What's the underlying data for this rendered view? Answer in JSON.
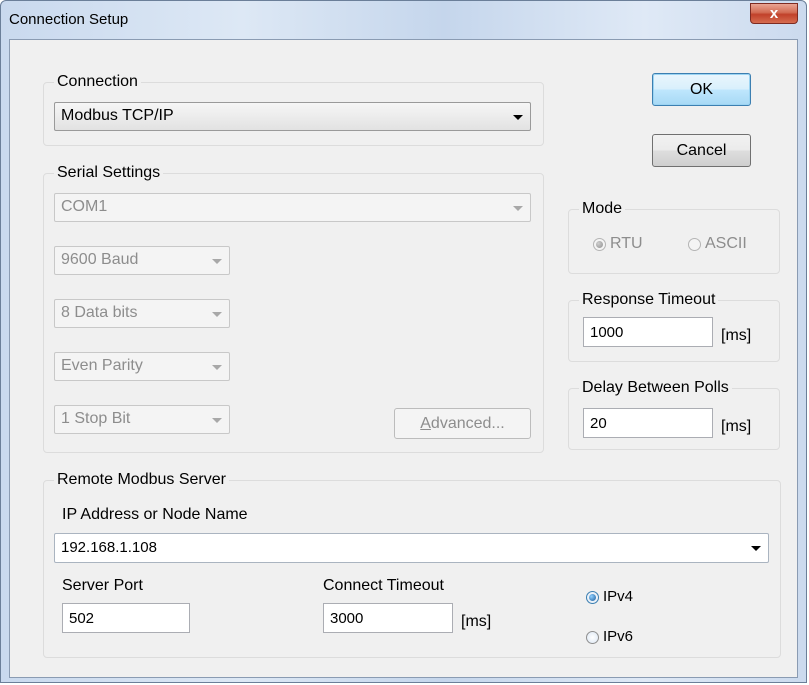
{
  "window": {
    "title": "Connection Setup",
    "close_glyph": "x"
  },
  "buttons": {
    "ok": "OK",
    "cancel": "Cancel",
    "advanced_prefix": "A",
    "advanced_rest": "dvanced..."
  },
  "connection": {
    "legend": "Connection",
    "selected": "Modbus TCP/IP"
  },
  "serial": {
    "legend": "Serial Settings",
    "port": "COM1",
    "baud": "9600 Baud",
    "data_bits": "8 Data bits",
    "parity": "Even Parity",
    "stop_bits": "1 Stop Bit"
  },
  "mode": {
    "legend": "Mode",
    "rtu": "RTU",
    "ascii": "ASCII",
    "selected": "RTU"
  },
  "response_timeout": {
    "legend": "Response Timeout",
    "value": "1000",
    "unit": "[ms]"
  },
  "delay_between_polls": {
    "legend": "Delay Between Polls",
    "value": "20",
    "unit": "[ms]"
  },
  "remote_server": {
    "legend": "Remote Modbus Server",
    "ip_label": "IP Address or Node Name",
    "ip_value": "192.168.1.108",
    "port_label": "Server Port",
    "port_value": "502",
    "connect_timeout_label": "Connect Timeout",
    "connect_timeout_value": "3000",
    "connect_timeout_unit": "[ms]",
    "ipv4": "IPv4",
    "ipv6": "IPv6",
    "ip_version_selected": "IPv4"
  },
  "icons": {
    "close": "close-icon",
    "dropdown": "chevron-down-icon"
  }
}
